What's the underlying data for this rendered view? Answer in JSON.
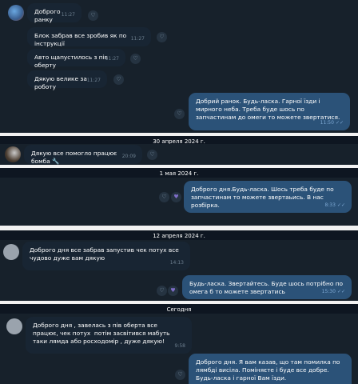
{
  "section1": {
    "incoming": [
      {
        "text": "Доброго ранку",
        "time": "11:27"
      },
      {
        "text": "Блок забрав все зробив як по інструкції",
        "time": "11:27"
      },
      {
        "text": "Авто щапустилось з пів оберту",
        "time": "11:27"
      },
      {
        "text": "Дякую велике за роботу",
        "time": "11:27"
      }
    ],
    "outgoing": {
      "text": "Добрий ранок. Будь-ласка. Гарної їзди і мирного неба. Треба буде шось по запчастинам до омеги то можете звертатися.",
      "time": "11:50"
    }
  },
  "date2": "30 апреля 2024 г.",
  "section2": {
    "incoming": {
      "text": "Дякую все помогло працює бомба 🔧",
      "time": "20:09"
    }
  },
  "date3": "1 мая 2024 г.",
  "section3": {
    "outgoing": {
      "text": "Доброго дня.Будь-ласка. Шось треба буде по запчастинам то можете звертаьись. В нас розбірка.",
      "time": "8:33"
    }
  },
  "date4": "12 апреля 2024 г.",
  "section4": {
    "incoming": {
      "text": "Доброго дня все забрав запустив чек потух все чудово дуже вам дякую",
      "time": "14:13"
    },
    "outgoing": {
      "text": "Будь-ласка. Звертайтесь. Буде шось потрібно по омега б то можете звертатись",
      "time": "15:30"
    }
  },
  "date5": "Сегодня",
  "section5": {
    "incoming": {
      "text": "Доброго дня , завелась з пів оберта все працює, чек потух  потім засвітився мабуть таки лямда або росходомір , дуже дякую!",
      "time": "9:58"
    },
    "outgoing": {
      "text": "Доброго дня. Я вам казав, що там помилка по лямбді висіла. Поміняєте і буде все добре. Будь-ласка і гарної Вам їзди."
    }
  },
  "icons": {
    "heart": "heart-icon",
    "check": "double-check-icon"
  }
}
